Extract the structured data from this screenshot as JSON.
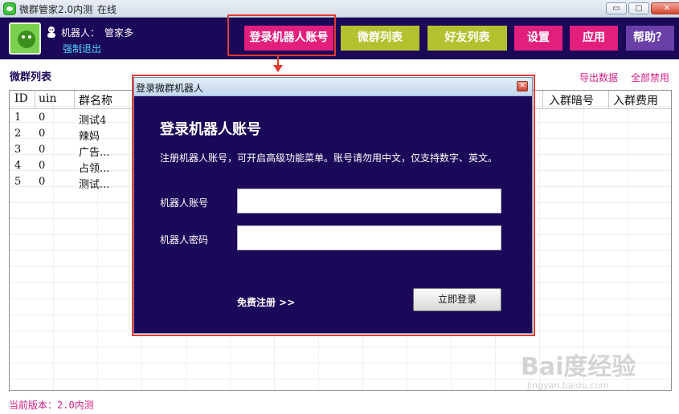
{
  "window": {
    "title": "微群管家2.0内测",
    "status": "在线",
    "controls": {
      "minimize": "▭",
      "maximize": "▢",
      "close": "✕"
    }
  },
  "header": {
    "robot_label": "机器人：",
    "robot_name": "管家多",
    "force_logout": "强制退出",
    "buttons": [
      {
        "label": "登录机器人账号"
      },
      {
        "label": "微群列表"
      },
      {
        "label": "好友列表"
      },
      {
        "label": "设置"
      },
      {
        "label": "应用"
      },
      {
        "label": "帮助？"
      }
    ]
  },
  "section": {
    "title": "微群列表",
    "export": "导出数据",
    "ban_all": "全部禁用"
  },
  "table": {
    "columns": [
      "ID",
      "uin",
      "群名称",
      "入群暗号",
      "入群费用"
    ],
    "rows": [
      [
        "1",
        "0",
        "测试4"
      ],
      [
        "2",
        "0",
        "辣妈"
      ],
      [
        "3",
        "0",
        "广告..."
      ],
      [
        "4",
        "0",
        "占领..."
      ],
      [
        "5",
        "0",
        "测试..."
      ]
    ]
  },
  "dialog": {
    "title": "登录微群机器人",
    "close": "✕",
    "heading": "登录机器人账号",
    "description": "注册机器人账号，可开启高级功能菜单。账号请勿用中文，仅支持数字、英文。",
    "account_label": "机器人账号",
    "account_value": "",
    "password_label": "机器人密码",
    "password_value": "",
    "register_link": "免费注册 >>",
    "login_button": "立即登录"
  },
  "footer": {
    "version": "当前版本：2.0内测"
  },
  "watermark": {
    "brand": "Bai度经验",
    "url": "jingyan.baidu.com"
  },
  "colors": {
    "header_bg": "#1b0859",
    "pink": "#e21f7c",
    "olive": "#b4c12f",
    "purple": "#6a40a8",
    "highlight": "#e33a2f",
    "link": "#d21f86"
  }
}
